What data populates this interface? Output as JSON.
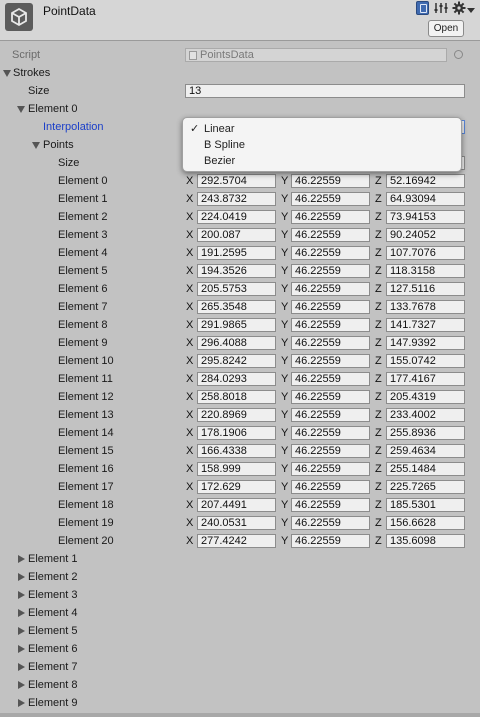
{
  "header": {
    "title": "PointData",
    "open_label": "Open"
  },
  "script_row": {
    "label": "Script",
    "value": "PointsData"
  },
  "strokes": {
    "label": "Strokes",
    "size_label": "Size",
    "size_value": "13"
  },
  "element0": {
    "label": "Element 0",
    "interpolation_label": "Interpolation",
    "points_label": "Points",
    "points_size_label": "Size"
  },
  "dropdown": {
    "options": [
      {
        "label": "Linear",
        "checked": "✓"
      },
      {
        "label": "B Spline",
        "checked": ""
      },
      {
        "label": "Bezier",
        "checked": ""
      }
    ]
  },
  "axes": {
    "x": "X",
    "y": "Y",
    "z": "Z"
  },
  "points": [
    {
      "label": "Element 0",
      "x": "292.5704",
      "y": "46.22559",
      "z": "52.16942"
    },
    {
      "label": "Element 1",
      "x": "243.8732",
      "y": "46.22559",
      "z": "64.93094"
    },
    {
      "label": "Element 2",
      "x": "224.0419",
      "y": "46.22559",
      "z": "73.94153"
    },
    {
      "label": "Element 3",
      "x": "200.087",
      "y": "46.22559",
      "z": "90.24052"
    },
    {
      "label": "Element 4",
      "x": "191.2595",
      "y": "46.22559",
      "z": "107.7076"
    },
    {
      "label": "Element 5",
      "x": "194.3526",
      "y": "46.22559",
      "z": "118.3158"
    },
    {
      "label": "Element 6",
      "x": "205.5753",
      "y": "46.22559",
      "z": "127.5116"
    },
    {
      "label": "Element 7",
      "x": "265.3548",
      "y": "46.22559",
      "z": "133.7678"
    },
    {
      "label": "Element 8",
      "x": "291.9865",
      "y": "46.22559",
      "z": "141.7327"
    },
    {
      "label": "Element 9",
      "x": "296.4088",
      "y": "46.22559",
      "z": "147.9392"
    },
    {
      "label": "Element 10",
      "x": "295.8242",
      "y": "46.22559",
      "z": "155.0742"
    },
    {
      "label": "Element 11",
      "x": "284.0293",
      "y": "46.22559",
      "z": "177.4167"
    },
    {
      "label": "Element 12",
      "x": "258.8018",
      "y": "46.22559",
      "z": "205.4319"
    },
    {
      "label": "Element 13",
      "x": "220.8969",
      "y": "46.22559",
      "z": "233.4002"
    },
    {
      "label": "Element 14",
      "x": "178.1906",
      "y": "46.22559",
      "z": "255.8936"
    },
    {
      "label": "Element 15",
      "x": "166.4338",
      "y": "46.22559",
      "z": "259.4634"
    },
    {
      "label": "Element 16",
      "x": "158.999",
      "y": "46.22559",
      "z": "255.1484"
    },
    {
      "label": "Element 17",
      "x": "172.629",
      "y": "46.22559",
      "z": "225.7265"
    },
    {
      "label": "Element 18",
      "x": "207.4491",
      "y": "46.22559",
      "z": "185.5301"
    },
    {
      "label": "Element 19",
      "x": "240.0531",
      "y": "46.22559",
      "z": "156.6628"
    },
    {
      "label": "Element 20",
      "x": "277.4242",
      "y": "46.22559",
      "z": "135.6098"
    }
  ],
  "collapsed_elements": [
    "Element 1",
    "Element 2",
    "Element 3",
    "Element 4",
    "Element 5",
    "Element 6",
    "Element 7",
    "Element 8",
    "Element 9"
  ]
}
